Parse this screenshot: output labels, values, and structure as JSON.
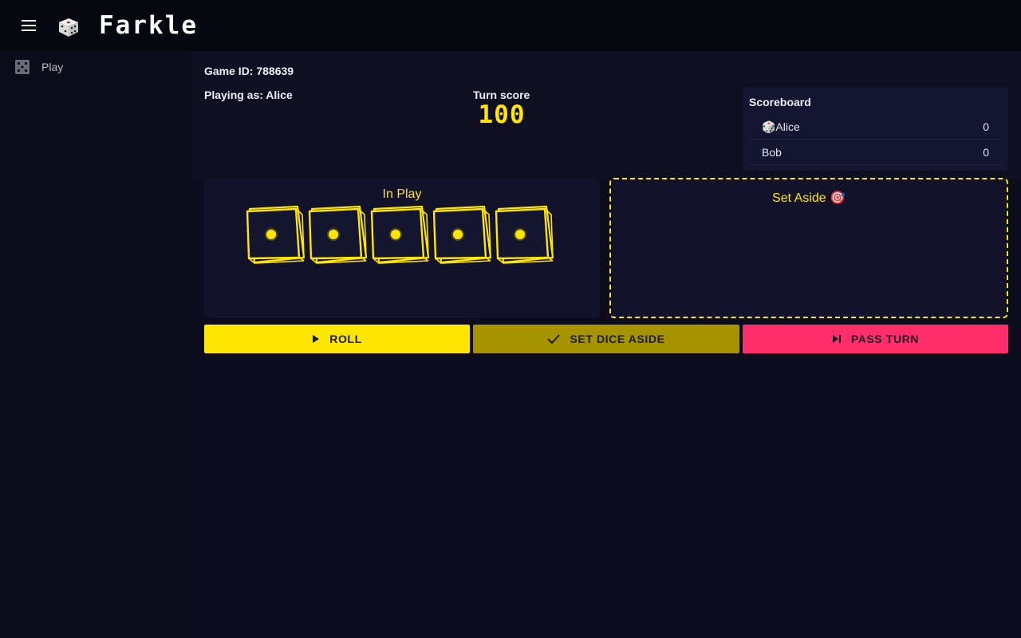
{
  "app": {
    "title": "Farkle",
    "logo_icon": "die-icon"
  },
  "sidebar": {
    "items": [
      {
        "label": "Play",
        "icon": "dice-icon"
      }
    ]
  },
  "game": {
    "game_id_label": "Game ID: 788639",
    "playing_as_prefix": "Playing as: ",
    "playing_as_name": "Alice",
    "turn_score_label": "Turn score",
    "turn_score": "100"
  },
  "scoreboard": {
    "title": "Scoreboard",
    "rows": [
      {
        "name": "🎲Alice",
        "score": "0"
      },
      {
        "name": "Bob",
        "score": "0"
      }
    ]
  },
  "in_play": {
    "title": "In Play",
    "dice": [
      1,
      1,
      1,
      1,
      1
    ]
  },
  "set_aside": {
    "title": "Set Aside 🎯",
    "dice": []
  },
  "actions": {
    "roll_label": "ROLL",
    "set_aside_label": "SET DICE ASIDE",
    "pass_label": "PASS TURN"
  },
  "colors": {
    "accent": "#ffe600",
    "set_aside_button": "#a59400",
    "pass_button": "#ff2e6a",
    "background": "#0b0b19"
  }
}
